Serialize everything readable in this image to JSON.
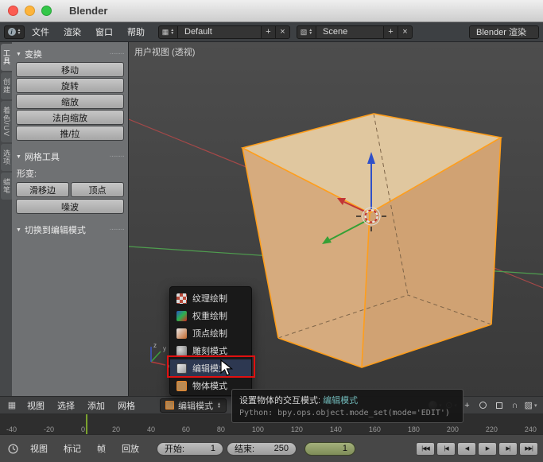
{
  "window": {
    "title": "Blender"
  },
  "info_header": {
    "menus": [
      "文件",
      "渲染",
      "窗口",
      "帮助"
    ],
    "screen_layout": {
      "value": "Default",
      "add": "+",
      "remove": "×"
    },
    "scene": {
      "value": "Scene",
      "add": "+",
      "remove": "×"
    },
    "render_engine": "Blender 渲染"
  },
  "tool_shelf": {
    "tabs": [
      "工具",
      "创建",
      "着色/UV",
      "选项",
      "蜡笔"
    ],
    "transform_panel": {
      "title": "变换",
      "buttons": [
        "移动",
        "旋转",
        "缩放",
        "法向缩放",
        "推/拉"
      ]
    },
    "mesh_tools_panel": {
      "title": "网格工具",
      "deform_label": "形变:",
      "row_buttons": [
        "滑移边",
        "顶点"
      ],
      "noise_button": "噪波"
    },
    "redo_panel": {
      "title": "切换到编辑模式"
    }
  },
  "viewport": {
    "view_label": "用户视图 (透视)",
    "axis_gizmo": {
      "x": "x",
      "y": "y",
      "z": "z"
    }
  },
  "viewport_header": {
    "menus": [
      "视图",
      "选择",
      "添加",
      "网格"
    ],
    "mode_selector": "编辑模式"
  },
  "mode_menu": {
    "items": [
      {
        "label": "纹理绘制"
      },
      {
        "label": "权重绘制"
      },
      {
        "label": "顶点绘制"
      },
      {
        "label": "雕刻模式"
      },
      {
        "label": "编辑模式",
        "highlighted": true
      },
      {
        "label": "物体模式"
      }
    ]
  },
  "tooltip": {
    "text": "设置物体的交互模式: ",
    "highlight": "编辑模式",
    "python": "Python: bpy.ops.object.mode_set(mode='EDIT')"
  },
  "timeline": {
    "ruler_labels": [
      "-40",
      "-20",
      "0",
      "20",
      "40",
      "60",
      "80",
      "100",
      "120",
      "140",
      "160",
      "180",
      "200",
      "220",
      "240"
    ],
    "menus": [
      "视图",
      "标记",
      "帧",
      "回放"
    ],
    "start_label": "开始:",
    "start_value": "1",
    "end_label": "结束:",
    "end_value": "250",
    "current_frame": "1",
    "playback": [
      "|◀◀",
      "|◀",
      "◀",
      "▶",
      "▶|",
      "▶▶|"
    ]
  },
  "colors": {
    "selection_orange": "#ff9e1b",
    "annotation_red": "#e01010",
    "tooltip_teal": "#6fb7b7",
    "frame_line_green": "#7ba22e"
  }
}
